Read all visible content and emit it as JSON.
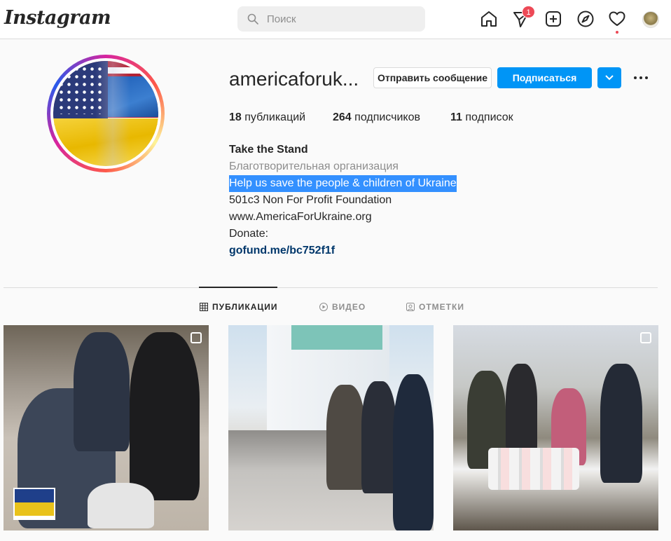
{
  "app": {
    "logo": "Instagram"
  },
  "search": {
    "placeholder": "Поиск"
  },
  "nav": {
    "notifications_count": "1",
    "icons": [
      "home-icon",
      "direct-icon",
      "new-post-icon",
      "explore-icon",
      "activity-icon",
      "profile-avatar"
    ]
  },
  "profile": {
    "username": "americaforuk...",
    "message_button": "Отправить сообщение",
    "follow_button": "Подписаться",
    "stats": {
      "posts_count": "18",
      "posts_label": "публикаций",
      "followers_count": "264",
      "followers_label": "подписчиков",
      "following_count": "11",
      "following_label": "подписок"
    },
    "bio": {
      "name": "Take the Stand",
      "category": "Благотворительная организация",
      "lines": [
        "Help us save the people & children of Ukraine",
        "501c3 Non For Profit Foundation",
        "www.AmericaForUkraine.org",
        "Donate:"
      ],
      "link": "gofund.me/bc752f1f"
    }
  },
  "tabs": [
    {
      "label": "ПУБЛИКАЦИИ",
      "active": true
    },
    {
      "label": "ВИДЕО",
      "active": false
    },
    {
      "label": "ОТМЕТКИ",
      "active": false
    }
  ],
  "colors": {
    "primary_blue": "#0095f6",
    "badge_red": "#ed4956",
    "selection_blue": "#3390ff"
  }
}
